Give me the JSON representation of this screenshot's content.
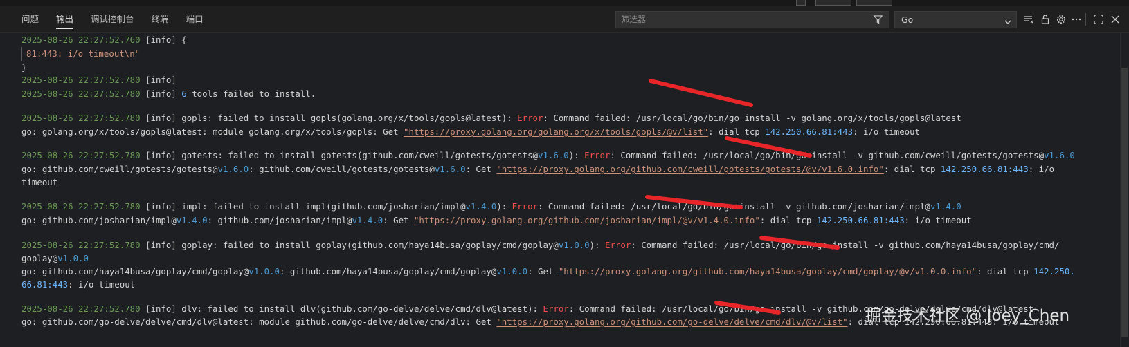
{
  "tabs": [
    {
      "label": "问题"
    },
    {
      "label": "输出",
      "active": true
    },
    {
      "label": "调试控制台"
    },
    {
      "label": "终端"
    },
    {
      "label": "端口"
    }
  ],
  "filter": {
    "placeholder": "筛选器"
  },
  "channel_select": {
    "value": "Go"
  },
  "toolbar_icons": [
    "clear-output-icon",
    "lock-scroll-icon",
    "settings-gear-icon",
    "more-actions-icon",
    "maximize-panel-icon",
    "close-panel-icon"
  ],
  "colors": {
    "background": "#1e1f22",
    "timestamp": "#6a9955",
    "string": "#ce9178",
    "number": "#6cb6ff",
    "error": "#f14c4c",
    "arrow": "#e8262a"
  },
  "output": {
    "l1": {
      "ts": "2025-08-26 22:27:52.760",
      "rest": " [info] {"
    },
    "l2": {
      "text": "81:443: i/o timeout\\n\""
    },
    "l3": {
      "text": "}"
    },
    "l4": {
      "ts": "2025-08-26 22:27:52.780",
      "rest": " [info]"
    },
    "l5": {
      "ts": "2025-08-26 22:27:52.780",
      "pre": " [info] ",
      "num": "6",
      "rest": " tools failed to install."
    },
    "gopls": {
      "ts": "2025-08-26 22:27:52.780",
      "a": " [info] gopls: failed to install gopls(golang.org/x/tools/gopls@latest): ",
      "err": "Error",
      "b": ": Command failed: /usr/local/go/bin/go install -v golang.org/x/tools/gopls@latest",
      "c": "go: golang.org/x/tools/gopls@latest: module golang.org/x/tools/gopls: Get ",
      "url": "\"https://proxy.golang.org/golang.org/x/tools/gopls/@v/list\"",
      "d": ": dial tcp ",
      "ip": "142.250.66.81:443",
      "e": ": i/o timeout"
    },
    "gotests": {
      "ts": "2025-08-26 22:27:52.780",
      "a": " [info] gotests: failed to install gotests(github.com/cweill/gotests/gotests@",
      "v": "v1.6.0",
      "a2": "): ",
      "err": "Error",
      "b": ": Command failed: /usr/local/go/bin/go install -v github.com/cweill/gotests/gotests@",
      "c": "go: github.com/cweill/gotests/gotests@",
      "c2": ": github.com/cweill/gotests/gotests@",
      "c3": ": Get ",
      "url": "\"https://proxy.golang.org/github.com/cweill/gotests/gotests/@v/v1.6.0.info\"",
      "d": ": dial tcp ",
      "ip": "142.250.66.81:443",
      "e": ": i/o",
      "f": "timeout"
    },
    "impl": {
      "ts": "2025-08-26 22:27:52.780",
      "a": " [info] impl: failed to install impl(github.com/josharian/impl@",
      "v": "v1.4.0",
      "a2": "): ",
      "err": "Error",
      "b": ": Command failed: /usr/local/go/bin/go install -v github.com/josharian/impl@",
      "c": "go: github.com/josharian/impl@",
      "c2": ": github.com/josharian/impl@",
      "c3": ": Get ",
      "url": "\"https://proxy.golang.org/github.com/josharian/impl/@v/v1.4.0.info\"",
      "d": ": dial tcp ",
      "ip": "142.250.66.81:443",
      "e": ": i/o timeout"
    },
    "goplay": {
      "ts": "2025-08-26 22:27:52.780",
      "a": " [info] goplay: failed to install goplay(github.com/haya14busa/goplay/cmd/goplay@",
      "v": "v1.0.0",
      "a2": "): ",
      "err": "Error",
      "b": ": Command failed: /usr/local/go/bin/go install -v github.com/haya14busa/goplay/cmd/",
      "b2": "goplay@",
      "c": "go: github.com/haya14busa/goplay/cmd/goplay@",
      "c2": ": github.com/haya14busa/goplay/cmd/goplay@",
      "c3": ": Get ",
      "url": "\"https://proxy.golang.org/github.com/haya14busa/goplay/cmd/goplay/@v/v1.0.0.info\"",
      "d": ": dial tcp ",
      "ip1": "142.250.",
      "ip2": "66.81:443",
      "e": ": i/o timeout"
    },
    "dlv": {
      "ts": "2025-08-26 22:27:52.780",
      "a": " [info] dlv: failed to install dlv(github.com/go-delve/delve/cmd/dlv@latest): ",
      "err": "Error",
      "b": ": Command failed: /usr/local/go/bin/go install -v github.com/go-delve/delve/cmd/dlv@latest",
      "c": "go: github.com/go-delve/delve/cmd/dlv@latest: module github.com/go-delve/delve/cmd/dlv: Get ",
      "url": "\"https://proxy.golang.org/github.com/go-delve/delve/cmd/dlv/@v/list\"",
      "d": ": dial tcp 142.250.66.81:443: i/o timeout"
    }
  },
  "watermark": "掘金技术社区 @ Joey_Chen"
}
